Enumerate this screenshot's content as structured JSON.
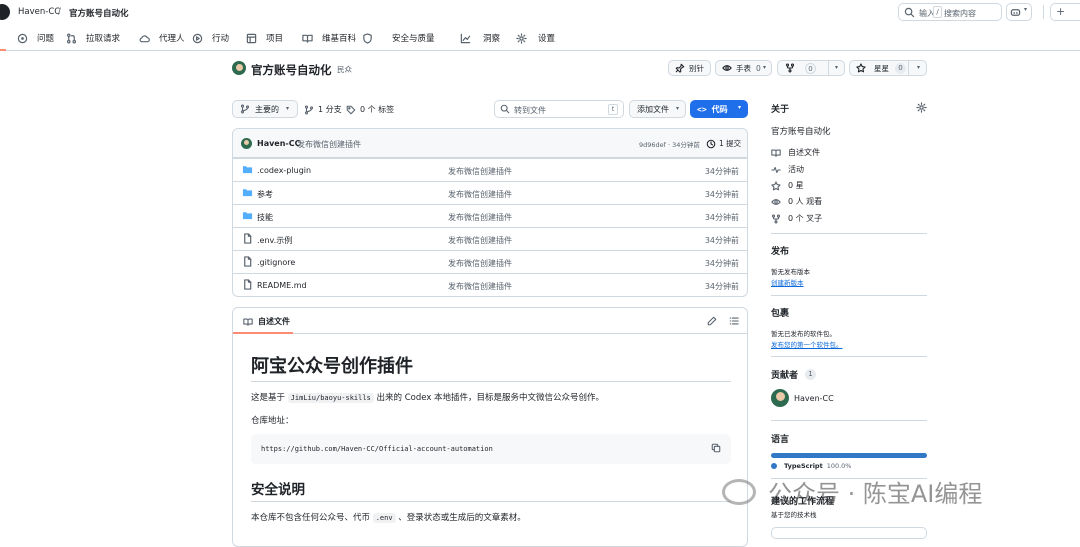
{
  "header": {
    "owner": "Haven-CC",
    "separator": "/",
    "repo": "官方账号自动化",
    "search_prefix": "输入",
    "search_key": "/",
    "search_suffix": "搜索内容",
    "plus": "+"
  },
  "nav": {
    "items": [
      {
        "label": "问题",
        "icon": "issue-icon"
      },
      {
        "label": "拉取请求",
        "icon": "pull-request-icon"
      },
      {
        "label": "代理人",
        "icon": "cloud-agent-icon"
      },
      {
        "label": "行动",
        "icon": "play-icon"
      },
      {
        "label": "项目",
        "icon": "table-icon"
      },
      {
        "label": "维基百科",
        "icon": "book-icon"
      },
      {
        "label": "安全与质量",
        "icon": "shield-icon"
      },
      {
        "label": "洞察",
        "icon": "graph-icon"
      },
      {
        "label": "设置",
        "icon": "gear-icon"
      }
    ]
  },
  "repo_header": {
    "title": "官方账号自动化",
    "visibility": "民众",
    "pin": "别针",
    "watch": "手表",
    "watch_count": "0",
    "fork_count": "0",
    "star": "星星",
    "star_count": "0"
  },
  "file_bar": {
    "branch": "主要的",
    "branches": "1 分支",
    "tags": "0 个 标签",
    "goto_placeholder": "转到文件",
    "goto_key": "t",
    "add_file": "添加文件",
    "code": "代码"
  },
  "commit": {
    "author": "Haven-CC",
    "message": "发布微信创建插件",
    "hash_time": "9d96def · 34分钟前",
    "commits": "1 提交"
  },
  "files": [
    {
      "name": ".codex-plugin",
      "type": "folder",
      "msg": "发布微信创建插件",
      "time": "34分钟前"
    },
    {
      "name": "参考",
      "type": "folder",
      "msg": "发布微信创建插件",
      "time": "34分钟前"
    },
    {
      "name": "技能",
      "type": "folder",
      "msg": "发布微信创建插件",
      "time": "34分钟前"
    },
    {
      "name": ".env.示例",
      "type": "file",
      "msg": "发布微信创建插件",
      "time": "34分钟前"
    },
    {
      "name": ".gitignore",
      "type": "file",
      "msg": "发布微信创建插件",
      "time": "34分钟前"
    },
    {
      "name": "README.md",
      "type": "file",
      "msg": "发布微信创建插件",
      "time": "34分钟前"
    }
  ],
  "readme": {
    "tab": "自述文件",
    "h1": "阿宝公众号创作插件",
    "p1_pre": "这是基于",
    "p1_code": "JimLiu/baoyu-skills",
    "p1_post": "出来的 Codex 本地插件，目标是服务中文微信公众号创作。",
    "p2": "仓库地址：",
    "url": "https://github.com/Haven-CC/Official-account-automation",
    "h2": "安全说明",
    "p3_pre": "本仓库不包含任何公众号、代币",
    "p3_code": ".env",
    "p3_post": "、登录状态或生成后的文章素材。"
  },
  "sidebar": {
    "about_title": "关于",
    "about_desc": "官方账号自动化",
    "readme": "自述文件",
    "activity": "活动",
    "stars": "0 星",
    "watching": "0 人 观看",
    "forks": "0 个 叉子",
    "releases_title": "发布",
    "releases_none": "暂无发布版本",
    "releases_link": "创建新版本",
    "packages_title": "包裹",
    "packages_none": "暂无已发布的软件包。",
    "packages_link": "发布您的第一个软件包。",
    "contributors_title": "贡献者",
    "contributors_count": "1",
    "contributor": "Haven-CC",
    "languages_title": "语言",
    "language": "TypeScript",
    "language_pct": "100.0%",
    "language_color": "#3178c6",
    "workflow_title": "建议的工作流程",
    "workflow_sub": "基于您的技术栈"
  },
  "watermark": "公众号 · 陈宝AI编程"
}
